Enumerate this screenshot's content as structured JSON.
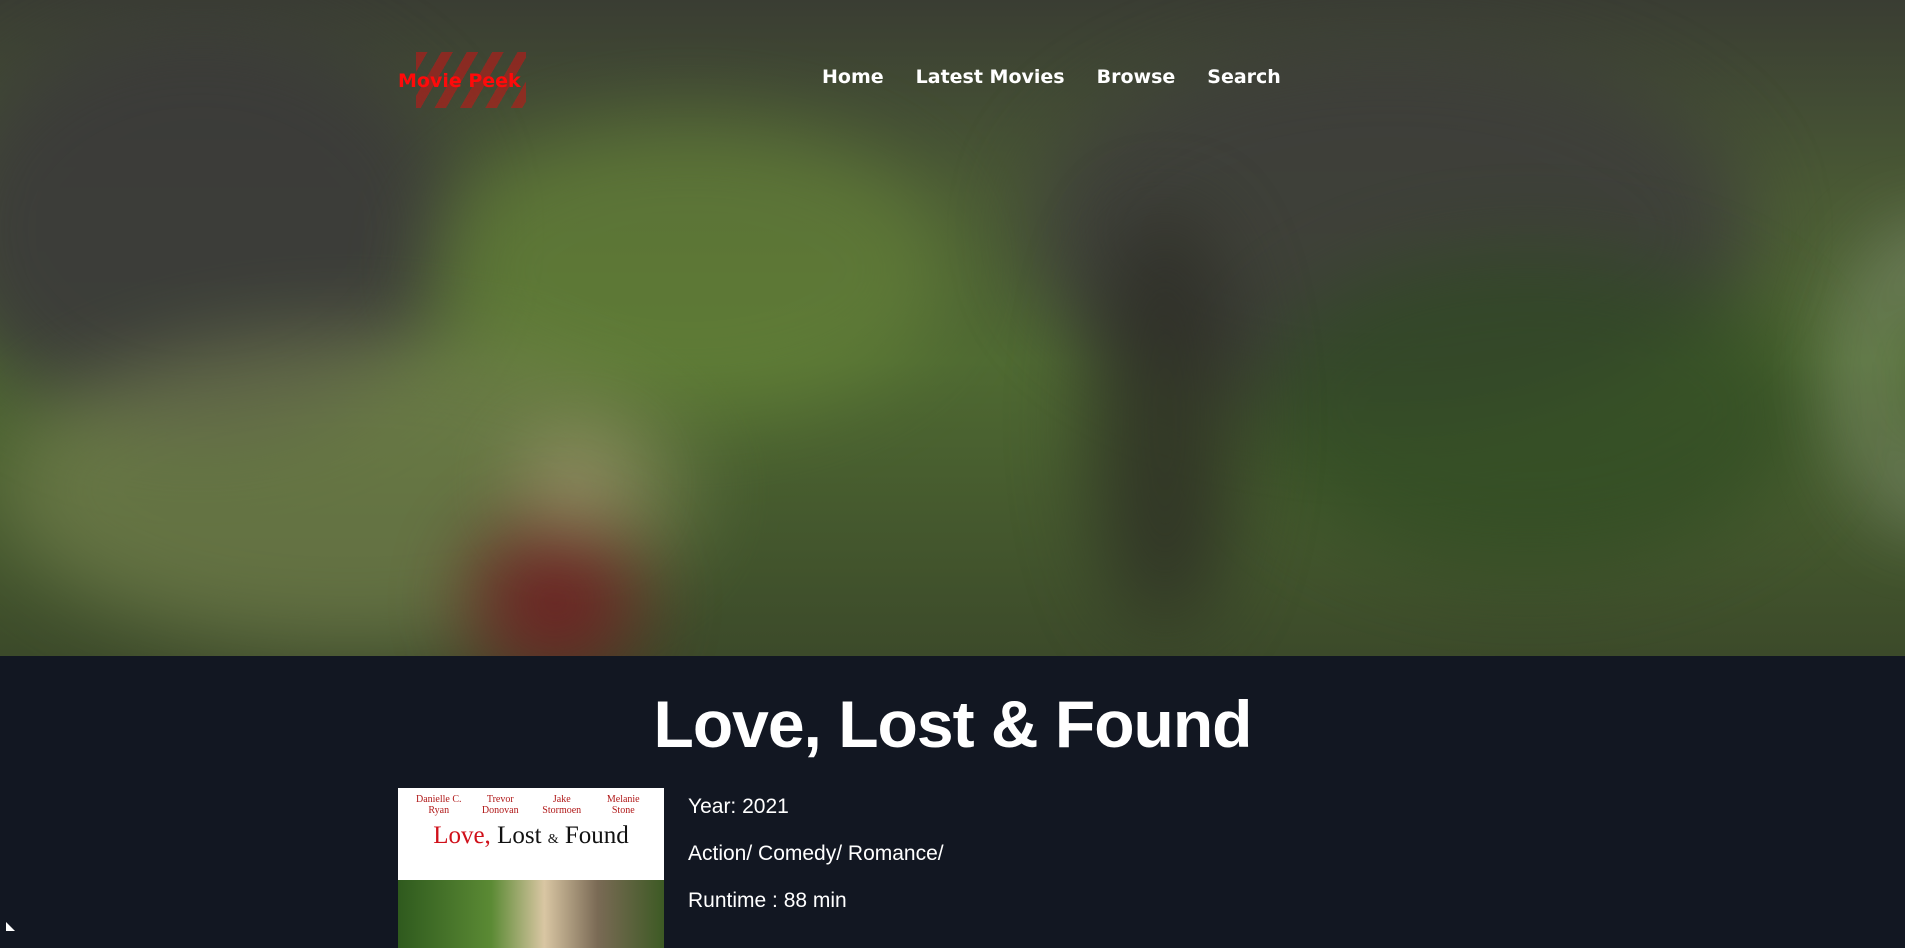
{
  "brand": {
    "name": "Movie Peek",
    "color": "#ff0a0a"
  },
  "nav": {
    "items": [
      "Home",
      "Latest Movies",
      "Browse",
      "Search"
    ]
  },
  "movie": {
    "title": "Love, Lost & Found",
    "year_line": "Year: 2021",
    "genres_line": "Action/ Comedy/ Romance/",
    "runtime_line": "Runtime : 88 min"
  },
  "poster": {
    "cast": [
      {
        "first": "Danielle C.",
        "last": "Ryan"
      },
      {
        "first": "Trevor",
        "last": "Donovan"
      },
      {
        "first": "Jake",
        "last": "Stormoen"
      },
      {
        "first": "Melanie",
        "last": "Stone"
      }
    ],
    "title_part1": "Love,",
    "title_part2": " Lost ",
    "title_amp": "&",
    "title_part3": " Found"
  },
  "colors": {
    "background": "#121722",
    "text": "#ffffff"
  }
}
